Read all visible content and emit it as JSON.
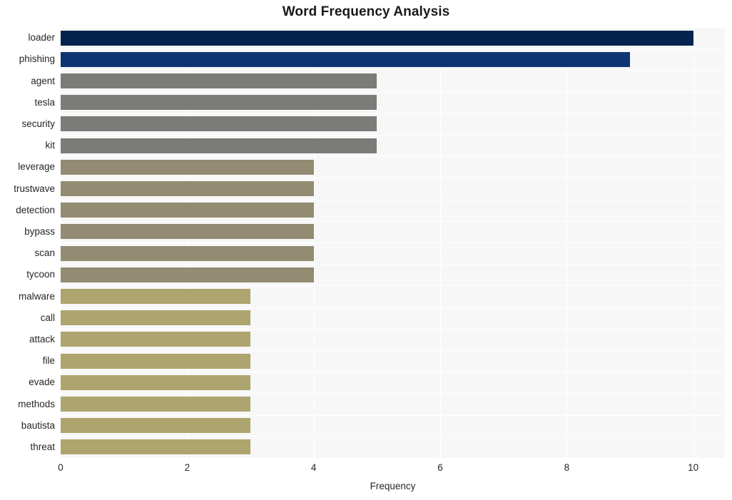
{
  "chart_data": {
    "type": "bar",
    "orientation": "horizontal",
    "title": "Word Frequency Analysis",
    "xlabel": "Frequency",
    "ylabel": "",
    "categories": [
      "loader",
      "phishing",
      "agent",
      "tesla",
      "security",
      "kit",
      "leverage",
      "trustwave",
      "detection",
      "bypass",
      "scan",
      "tycoon",
      "malware",
      "call",
      "attack",
      "file",
      "evade",
      "methods",
      "bautista",
      "threat"
    ],
    "values": [
      10,
      9,
      5,
      5,
      5,
      5,
      4,
      4,
      4,
      4,
      4,
      4,
      3,
      3,
      3,
      3,
      3,
      3,
      3,
      3
    ],
    "bar_colors": [
      "#04244f",
      "#0e3472",
      "#7b7b78",
      "#7b7b78",
      "#7b7b78",
      "#7b7b78",
      "#938b72",
      "#938b72",
      "#938b72",
      "#938b72",
      "#938b72",
      "#938b72",
      "#ada46e",
      "#ada46e",
      "#ada46e",
      "#ada46e",
      "#ada46e",
      "#ada46e",
      "#ada46e",
      "#ada46e"
    ],
    "xlim": [
      0,
      10.5
    ],
    "xticks": [
      0,
      2,
      4,
      6,
      8,
      10
    ],
    "xtick_labels": [
      "0",
      "2",
      "4",
      "6",
      "8",
      "10"
    ],
    "grid": true,
    "grid_color": "#ffffff",
    "plot_background": "#f7f7f7",
    "figure_background": "#ffffff",
    "legend": null
  }
}
